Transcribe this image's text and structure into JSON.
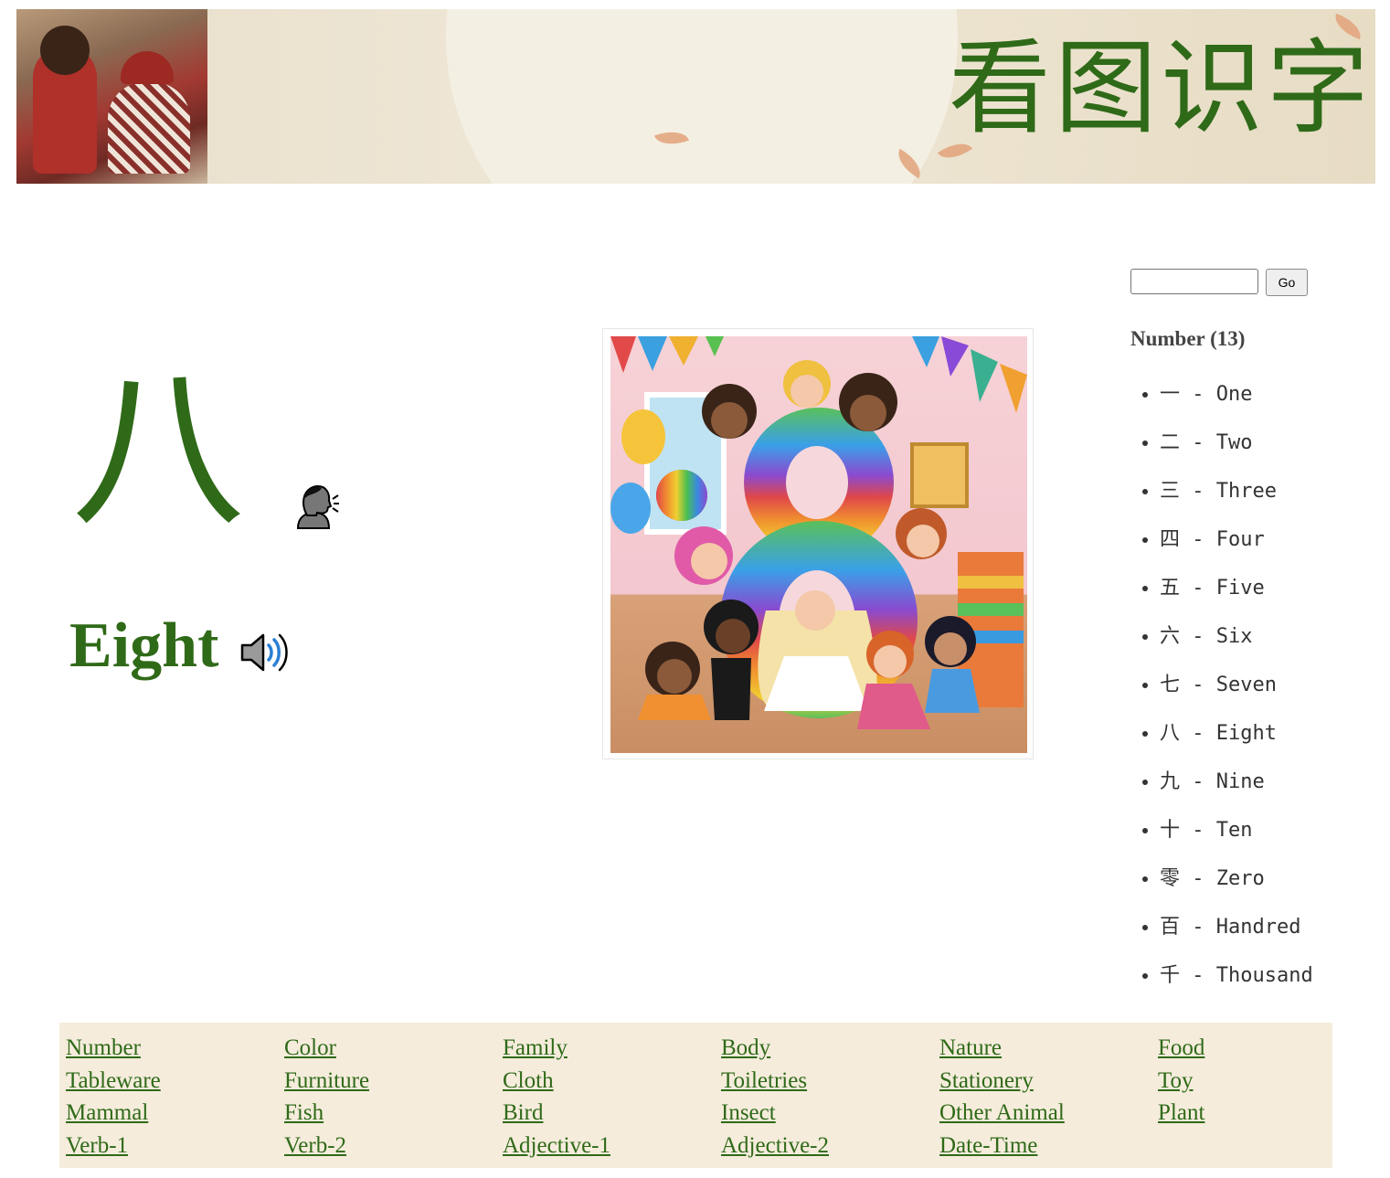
{
  "banner": {
    "title": "看图识字"
  },
  "search": {
    "value": "",
    "button_label": "Go"
  },
  "word": {
    "hanzi": "八",
    "english": "Eight"
  },
  "sidebar": {
    "heading": "Number (13)",
    "items": [
      {
        "label": "一 - One"
      },
      {
        "label": "二 - Two"
      },
      {
        "label": "三 - Three"
      },
      {
        "label": "四 - Four"
      },
      {
        "label": "五 - Five"
      },
      {
        "label": "六 - Six"
      },
      {
        "label": "七 - Seven"
      },
      {
        "label": "八 - Eight"
      },
      {
        "label": "九 - Nine"
      },
      {
        "label": "十 - Ten"
      },
      {
        "label": "零 - Zero"
      },
      {
        "label": "百 - Handred"
      },
      {
        "label": "千 - Thousand"
      }
    ]
  },
  "categories": [
    "Number",
    "Color",
    "Family",
    "Body",
    "Nature",
    "Food",
    "Tableware",
    "Furniture",
    "Cloth",
    "Toiletries",
    "Stationery",
    "Toy",
    "Mammal",
    "Fish",
    "Bird",
    "Insect",
    "Other Animal",
    "Plant",
    "Verb-1",
    "Verb-2",
    "Adjective-1",
    "Adjective-2",
    "Date-Time"
  ],
  "colors": {
    "accent_green": "#2f6a18",
    "footer_bg": "#f5ecdc"
  },
  "icons": {
    "pronounce": "speaking-head-icon",
    "audio": "speaker-high-volume-icon"
  }
}
